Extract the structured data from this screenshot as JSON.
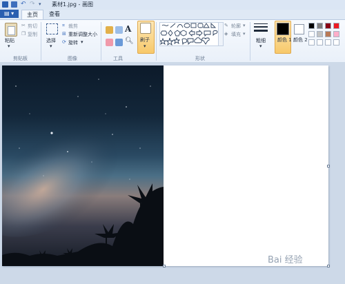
{
  "titlebar": {
    "title": "素材1.jpg - 画图"
  },
  "tabs": {
    "file": "▤ ▾",
    "home": "主页",
    "view": "查看"
  },
  "clipboard": {
    "paste": "粘贴",
    "cut": "剪切",
    "copy": "复制",
    "group": "剪贴板"
  },
  "image": {
    "select": "选择",
    "crop": "裁剪",
    "resize": "重新调整大小",
    "rotate": "旋转",
    "group": "图像"
  },
  "tools": {
    "group": "工具"
  },
  "brushes": {
    "label": "刷子"
  },
  "shapes": {
    "outline": "轮廓",
    "fill": "填充",
    "group": "形状"
  },
  "size": {
    "label": "粗细"
  },
  "colors": {
    "color1_label": "颜色 1",
    "color2_label": "颜色 2",
    "color1": "#000000",
    "color2": "#ffffff",
    "palette_row1": [
      "#000000",
      "#7f7f7f",
      "#880015",
      "#ed1c24"
    ],
    "palette_row2": [
      "#ffffff",
      "#c3c3c3",
      "#b97a57",
      "#ffaec9"
    ],
    "palette_row3": [
      "#ffffff",
      "#ffffff",
      "#ffffff",
      "#ffffff"
    ]
  },
  "watermark": {
    "text": "Bai 经验"
  }
}
